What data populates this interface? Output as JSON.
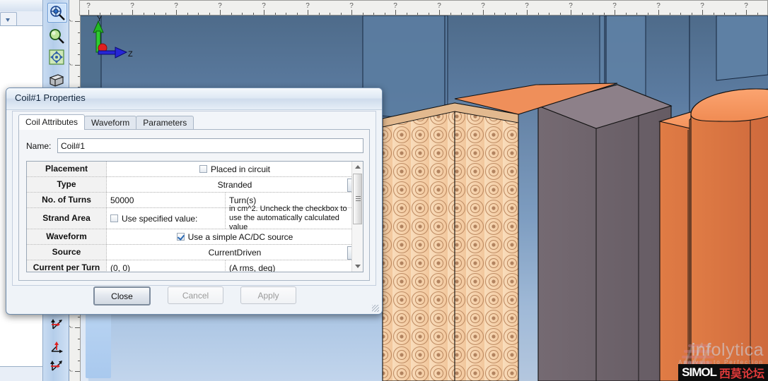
{
  "window": {
    "left_panel_tab_icon": "chevron-down-icon",
    "minimize_label": "▾",
    "close_label": "✕"
  },
  "toolbar": {
    "items": [
      {
        "name": "zoom-region-icon",
        "selected": true
      },
      {
        "name": "magnifier-zoom-icon",
        "selected": false
      },
      {
        "name": "pan-rotate-icon",
        "selected": false
      },
      {
        "name": "view-box-icon",
        "selected": false
      }
    ],
    "axis_items": [
      {
        "name": "axis-xyz-icon"
      },
      {
        "name": "axis-xy-icon"
      },
      {
        "name": "axis-global-icon"
      }
    ]
  },
  "ruler": {
    "tick_label": "?",
    "major_spacing_px": 62,
    "minor_per_major": 4
  },
  "viewport": {
    "triad": {
      "y_label": "Y",
      "z_label": "Z",
      "y_color": "#22bb22",
      "z_color": "#1a1ad0",
      "x_color": "#e02020"
    },
    "colors": {
      "bg_top": "#4e6b8a",
      "bg_bottom": "#c2d5ec",
      "coil_copper": "#d9713f",
      "coil_copper_light": "#f4996a",
      "coil_side_dark": "#6b6169",
      "winding_face": "#f7d3ac",
      "winding_ring": "#c79b76",
      "outline": "#111111"
    },
    "watermark": {
      "brand": "infolytica",
      "tagline": "Analysis to Perfection",
      "banner_latin": "SIMOL",
      "banner_cjk": "西莫论坛"
    }
  },
  "dialog": {
    "title": "Coil#1 Properties",
    "tabs": [
      {
        "label": "Coil Attributes",
        "active": true
      },
      {
        "label": "Waveform",
        "active": false
      },
      {
        "label": "Parameters",
        "active": false
      }
    ],
    "name_field": {
      "label": "Name:",
      "value": "Coil#1",
      "placeholder": "Coil#1"
    },
    "grid_rows": [
      {
        "header": "Placement",
        "type": "checkbox",
        "checked": false,
        "checkbox_label": "Placed in circuit"
      },
      {
        "header": "Type",
        "type": "dropdown",
        "value": "Stranded",
        "dropdown_icon": "chevron-down-icon"
      },
      {
        "header": "No. of Turns",
        "type": "split",
        "value": "50000",
        "unit": "Turn(s)"
      },
      {
        "header": "Strand Area",
        "type": "split-checkbox",
        "checked": false,
        "checkbox_label": "Use specified value:",
        "value": "",
        "unit": "in cm^2. Uncheck the checkbox to use the automatically calculated value"
      },
      {
        "header": "Waveform",
        "type": "checkbox",
        "checked": true,
        "checkbox_label": "Use a simple AC/DC source"
      },
      {
        "header": "Source",
        "type": "dropdown",
        "value": "CurrentDriven",
        "dropdown_icon": "chevron-down-icon"
      },
      {
        "header": "Current per Turn",
        "type": "split",
        "value": "(0, 0)",
        "unit": "(A rms, deg)"
      }
    ],
    "scrollbar": {
      "up_icon": "triangle-up-icon",
      "down_icon": "triangle-down-icon",
      "thumb_grip_icon": "grip-lines-icon"
    },
    "buttons": [
      {
        "label": "Close",
        "state": "default"
      },
      {
        "label": "Cancel",
        "state": "disabled"
      },
      {
        "label": "Apply",
        "state": "disabled"
      }
    ],
    "resizer_icon": "resize-grip-icon"
  }
}
